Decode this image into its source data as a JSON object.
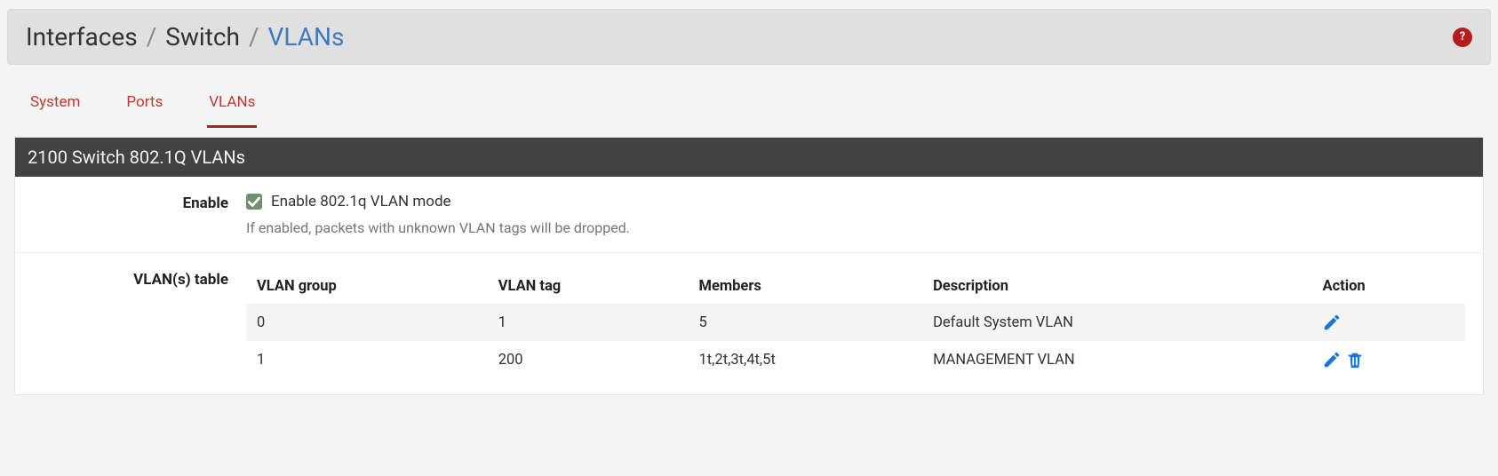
{
  "breadcrumb": {
    "items": [
      "Interfaces",
      "Switch",
      "VLANs"
    ],
    "active_index": 2
  },
  "tabs": {
    "items": [
      "System",
      "Ports",
      "VLANs"
    ],
    "active_index": 2
  },
  "panel": {
    "title": "2100 Switch 802.1Q VLANs"
  },
  "enable_section": {
    "label": "Enable",
    "checkbox_checked": true,
    "checkbox_label": "Enable 802.1q VLAN mode",
    "help_text": "If enabled, packets with unknown VLAN tags will be dropped."
  },
  "vlan_table": {
    "label": "VLAN(s) table",
    "columns": [
      "VLAN group",
      "VLAN tag",
      "Members",
      "Description",
      "Action"
    ],
    "rows": [
      {
        "group": "0",
        "tag": "1",
        "members": "5",
        "description": "Default System VLAN",
        "can_delete": false
      },
      {
        "group": "1",
        "tag": "200",
        "members": "1t,2t,3t,4t,5t",
        "description": "MANAGEMENT VLAN",
        "can_delete": true
      }
    ]
  }
}
